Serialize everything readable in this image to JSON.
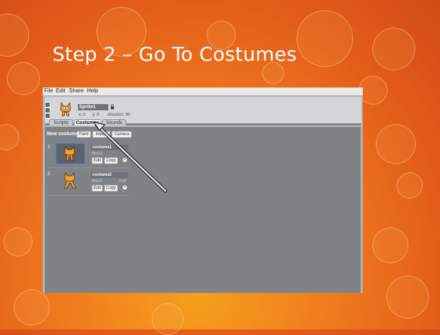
{
  "slide": {
    "title": "Step 2 – Go To Costumes"
  },
  "menu": {
    "file": "File",
    "edit": "Edit",
    "share": "Share",
    "help": "Help"
  },
  "sprite": {
    "name": "Sprite1",
    "x_label": "x: 0",
    "y_label": "y: 0",
    "direction_label": "direction: 90"
  },
  "tabs": {
    "scripts": "Scripts",
    "costumes": "Costumes",
    "sounds": "Sounds"
  },
  "new_costume": {
    "label": "New costume:",
    "paint": "Paint",
    "import": "Import",
    "camera": "Camera"
  },
  "costumes": [
    {
      "number": "1",
      "name": "costume1",
      "size_text": "95x111",
      "edit": "Edit",
      "copy": "Copy"
    },
    {
      "number": "2",
      "name": "costume2",
      "size_text": "95x111",
      "kb": "3 KB",
      "edit": "Edit",
      "copy": "Copy"
    }
  ],
  "colors": {
    "accent": "#f7a21e",
    "app_bg": "#7f8387"
  }
}
